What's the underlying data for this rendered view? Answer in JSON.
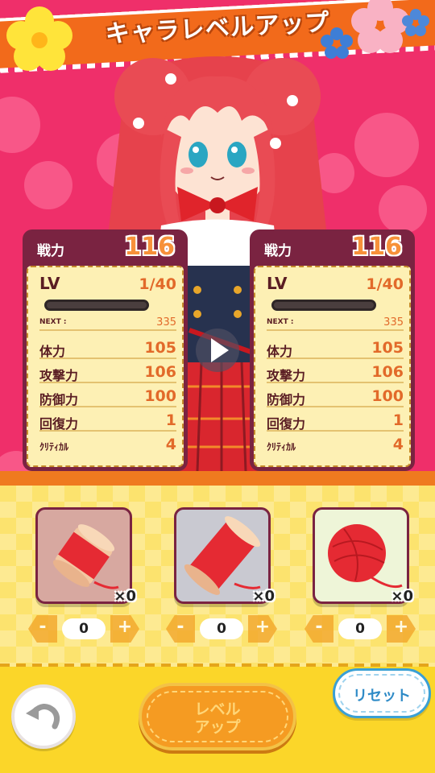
{
  "header": {
    "title": "キャラレベルアップ"
  },
  "cards": [
    {
      "power_label": "戦力",
      "power": "116",
      "lv_label": "LV",
      "lv": "1/40",
      "exp_fraction": 0.0,
      "next_label": "NEXT :",
      "next": "335",
      "stats": [
        {
          "label": "体力",
          "value": "105"
        },
        {
          "label": "攻撃力",
          "value": "106"
        },
        {
          "label": "防御力",
          "value": "100"
        },
        {
          "label": "回復力",
          "value": "1"
        },
        {
          "label": "ｸﾘﾃｨｶﾙ",
          "value": "4"
        }
      ]
    },
    {
      "power_label": "戦力",
      "power": "116",
      "lv_label": "LV",
      "lv": "1/40",
      "exp_fraction": 0.0,
      "next_label": "NEXT :",
      "next": "335",
      "stats": [
        {
          "label": "体力",
          "value": "105"
        },
        {
          "label": "攻撃力",
          "value": "106"
        },
        {
          "label": "防御力",
          "value": "100"
        },
        {
          "label": "回復力",
          "value": "1"
        },
        {
          "label": "ｸﾘﾃｨｶﾙ",
          "value": "4"
        }
      ]
    }
  ],
  "items": [
    {
      "icon": "thread-spool-small-icon",
      "count": "×0",
      "amount": "0",
      "minus": "-",
      "plus": "+",
      "bg": "#d7a8a0"
    },
    {
      "icon": "thread-spool-large-icon",
      "count": "×0",
      "amount": "0",
      "minus": "-",
      "plus": "+",
      "bg": "#c9c9d1"
    },
    {
      "icon": "yarn-ball-icon",
      "count": "×0",
      "amount": "0",
      "minus": "-",
      "plus": "+",
      "bg": "#eef5d8"
    }
  ],
  "buttons": {
    "level_up_line1": "レベル",
    "level_up_line2": "アップ",
    "reset": "リセット"
  },
  "colors": {
    "scene_bg": "#ef2f6a",
    "header_band": "#f26a1b",
    "card_frame": "#7a2341",
    "stat_value": "#e26a2a",
    "items_bg": "#fce36e"
  }
}
